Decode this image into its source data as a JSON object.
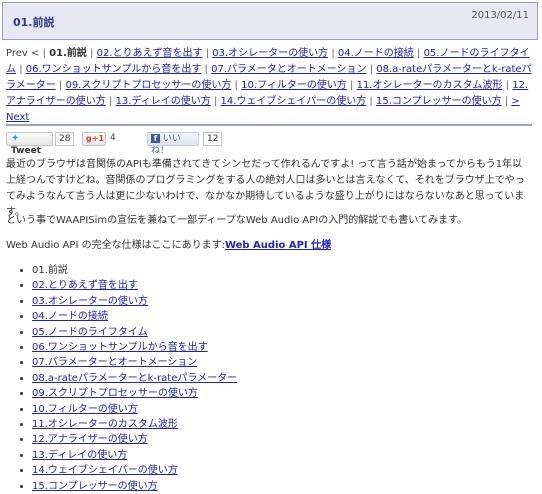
{
  "header": {
    "title": "01.前説",
    "date": "2013/02/11"
  },
  "nav": {
    "prev": "Prev <",
    "current": "01.前説",
    "links": [
      "02.とりあえず音を出す",
      "03.オシレーターの使い方",
      "04.ノードの接続",
      "05.ノードのライフタイム",
      "06.ワンショットサンプルから音を出す",
      "07.パラメータとオートメーション",
      "08.a-rateパラメーターとk-rateパラメーター",
      "09.スクリプトプロセッサーの使い方",
      "10.フィルターの使い方",
      "11.オシレーターのカスタム波形",
      "12.アナライザーの使い方",
      "13.ディレイの使い方",
      "14.ウェイブシェイパーの使い方",
      "15.コンプレッサーの使い方"
    ],
    "next": "> Next"
  },
  "social": {
    "tweet_label": "Tweet",
    "tweet_count": "28",
    "gplus_label": "+1",
    "gplus_count": "4",
    "like_label": "いいね！",
    "like_count": "12"
  },
  "body": {
    "p1": "最近のブラウザは音関係のAPIも準備されてきてシンセだって作れるんですよ! って言う話が始まってからもう1年以上経つんですけどね。音関係のプログラミングをする人の絶対人口は多いとは言えなくて、それをブラウザ上でやってみようなんて言う人は更に少ないわけで、なかなか期待しているような盛り上がりにはならないなあと思っています。",
    "p2": "という事でWAAPISimの宣伝を兼ねて一部ディープなWeb Audio APIの入門的解説でも書いてみます。",
    "p3_prefix": "Web Audio API の完全な仕様はここにあります:",
    "p3_link": "Web Audio API 仕様"
  },
  "toc": [
    "01.前説",
    "02.とりあえず音を出す",
    "03.オシレーターの使い方",
    "04.ノードの接続",
    "05.ノードのライフタイム",
    "06.ワンショットサンプルから音を出す",
    "07.パラメーターとオートメーション",
    "08.a-rateパラメーターとk-rateパラメーター",
    "09.スクリプトプロセッサーの使い方",
    "10.フィルターの使い方",
    "11.オシレーターのカスタム波形",
    "12.アナライザーの使い方",
    "13.ディレイの使い方",
    "14.ウェイブシェイパーの使い方",
    "15.コンプレッサーの使い方"
  ]
}
